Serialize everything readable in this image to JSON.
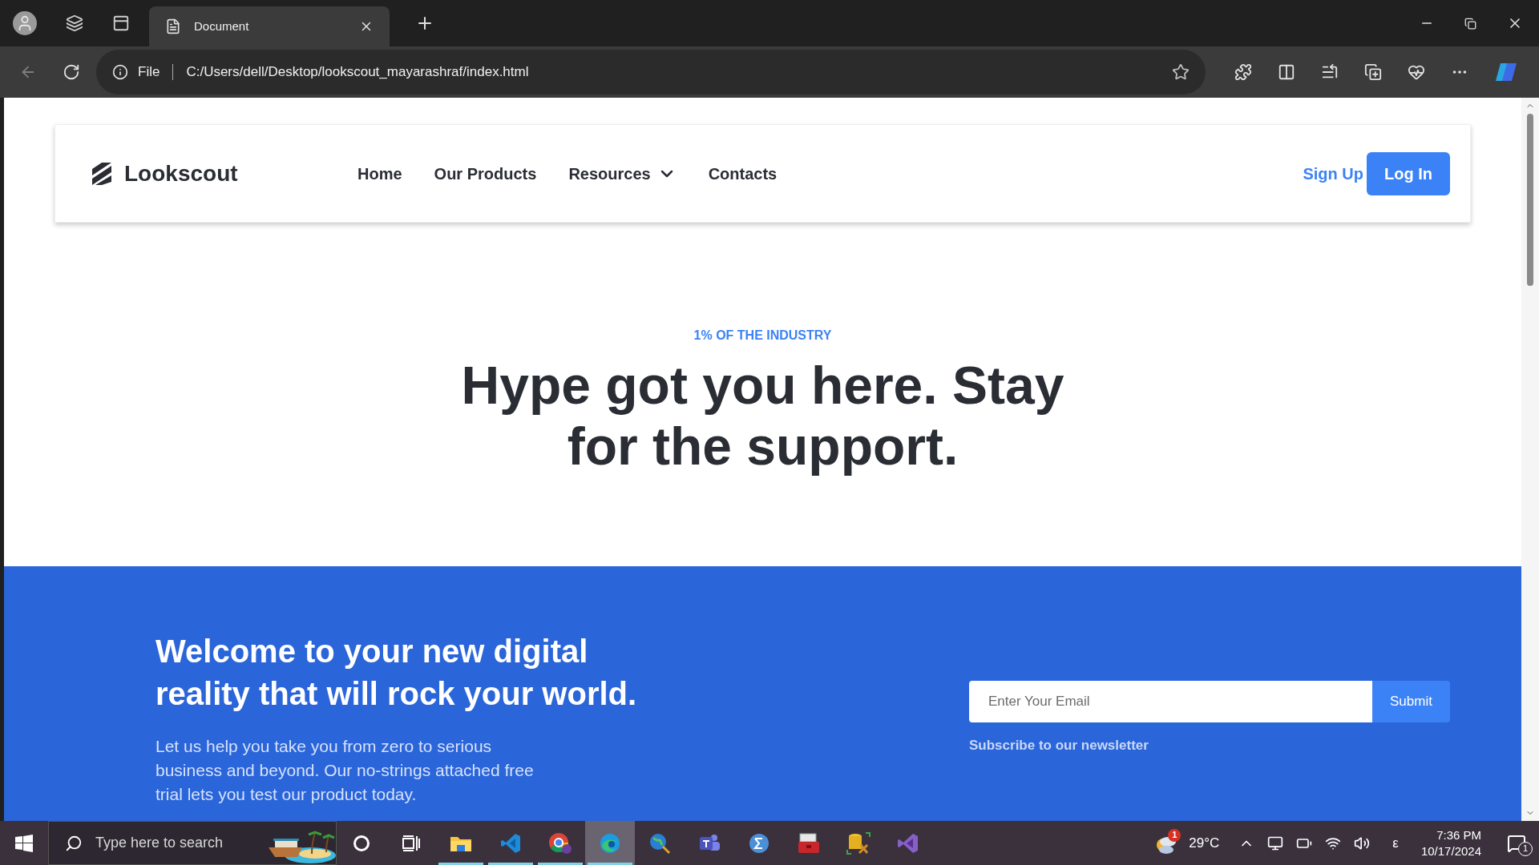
{
  "browser": {
    "tabs": [
      {
        "title": "Document",
        "selected": true
      }
    ],
    "address": {
      "scheme": "File",
      "url": "C:/Users/dell/Desktop/lookscout_mayarashraf/index.html"
    }
  },
  "navbar": {
    "logo": "Lookscout",
    "links": [
      {
        "label": "Home",
        "dropdown": false
      },
      {
        "label": "Our Products",
        "dropdown": false
      },
      {
        "label": "Resources",
        "dropdown": true
      },
      {
        "label": "Contacts",
        "dropdown": false
      }
    ],
    "sign_up": "Sign Up",
    "log_in": "Log In"
  },
  "hero": {
    "eyebrow": "1% OF THE INDUSTRY",
    "heading_lines": [
      "Hype got you here. Stay",
      "for the support."
    ]
  },
  "cta": {
    "heading_lines": [
      "Welcome to your new digital",
      "reality that will rock your world."
    ],
    "text": "Let us help you take you from zero to serious business and beyond. Our no-strings attached free trial lets you test our product today.",
    "email": {
      "placeholder": "Enter Your Email"
    },
    "submit": "Submit",
    "note": "Subscribe to our newsletter"
  },
  "taskbar": {
    "search": {
      "placeholder": "Type here to search"
    },
    "apps": [
      {
        "kind": "explorer",
        "running": true,
        "selected": false
      },
      {
        "kind": "vscode",
        "running": true,
        "selected": false
      },
      {
        "kind": "chrome",
        "running": true,
        "selected": false
      },
      {
        "kind": "edge",
        "running": true,
        "selected": true
      },
      {
        "kind": "globe",
        "running": false,
        "selected": false
      },
      {
        "kind": "teams",
        "running": false,
        "selected": false
      },
      {
        "kind": "sigma",
        "running": false,
        "selected": false
      },
      {
        "kind": "toolbox",
        "running": false,
        "selected": false
      },
      {
        "kind": "database",
        "running": false,
        "selected": false
      },
      {
        "kind": "studio",
        "running": false,
        "selected": false
      }
    ],
    "weather_badge": "1",
    "temperature": "29°C",
    "language": "ε",
    "time": "7:36 PM",
    "date": "10/17/2024",
    "notifications": "1"
  }
}
